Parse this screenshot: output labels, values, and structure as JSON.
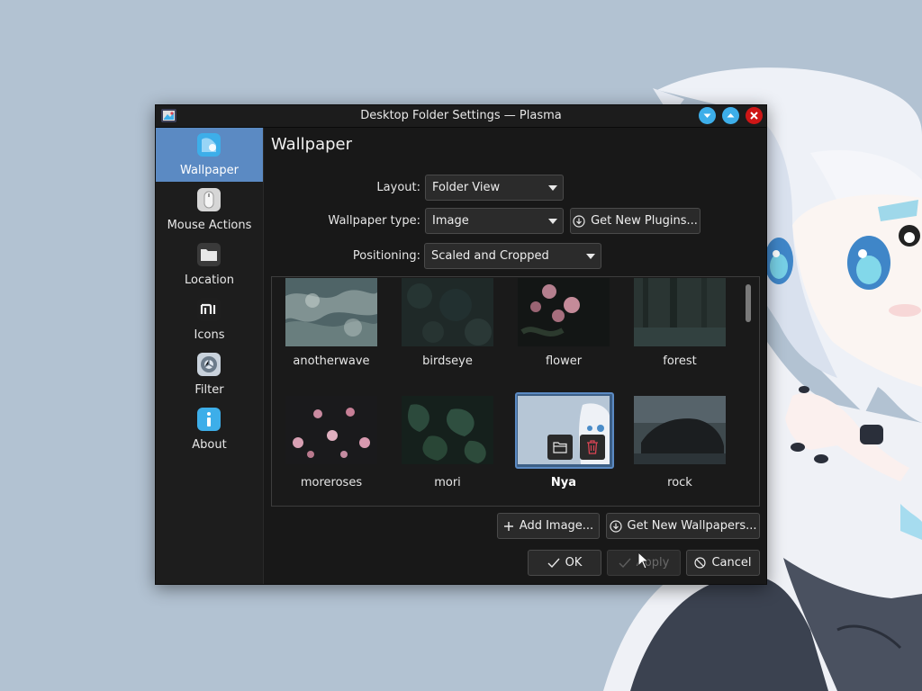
{
  "window": {
    "title": "Desktop Folder Settings — Plasma",
    "controls": [
      "minimize-icon",
      "maximize-icon",
      "close-icon"
    ]
  },
  "sidebar": {
    "items": [
      {
        "label": "Wallpaper",
        "icon": "wallpaper-icon",
        "active": true
      },
      {
        "label": "Mouse Actions",
        "icon": "mouse-icon",
        "active": false
      },
      {
        "label": "Location",
        "icon": "folder-icon",
        "active": false
      },
      {
        "label": "Icons",
        "icon": "icons-icon",
        "active": false
      },
      {
        "label": "Filter",
        "icon": "filter-icon",
        "active": false
      },
      {
        "label": "About",
        "icon": "info-icon",
        "active": false
      }
    ]
  },
  "page": {
    "title": "Wallpaper",
    "layout_label": "Layout:",
    "layout_value": "Folder View",
    "wallpaper_type_label": "Wallpaper type:",
    "wallpaper_type_value": "Image",
    "get_plugins_label": "Get New Plugins...",
    "positioning_label": "Positioning:",
    "positioning_value": "Scaled and Cropped"
  },
  "wallpapers": [
    {
      "name": "anotherwave",
      "selected": false
    },
    {
      "name": "birdseye",
      "selected": false
    },
    {
      "name": "flower",
      "selected": false
    },
    {
      "name": "forest",
      "selected": false
    },
    {
      "name": "moreroses",
      "selected": false
    },
    {
      "name": "mori",
      "selected": false
    },
    {
      "name": "Nya",
      "selected": true
    },
    {
      "name": "rock",
      "selected": false
    }
  ],
  "actions": {
    "add_image": "Add Image...",
    "get_wallpapers": "Get New Wallpapers...",
    "ok": "OK",
    "apply": "Apply",
    "cancel": "Cancel"
  },
  "colors": {
    "accent": "#5b8ac3",
    "window_bg": "#181818",
    "desktop_bg": "#b2c2d2",
    "delete_red": "#da4453"
  }
}
